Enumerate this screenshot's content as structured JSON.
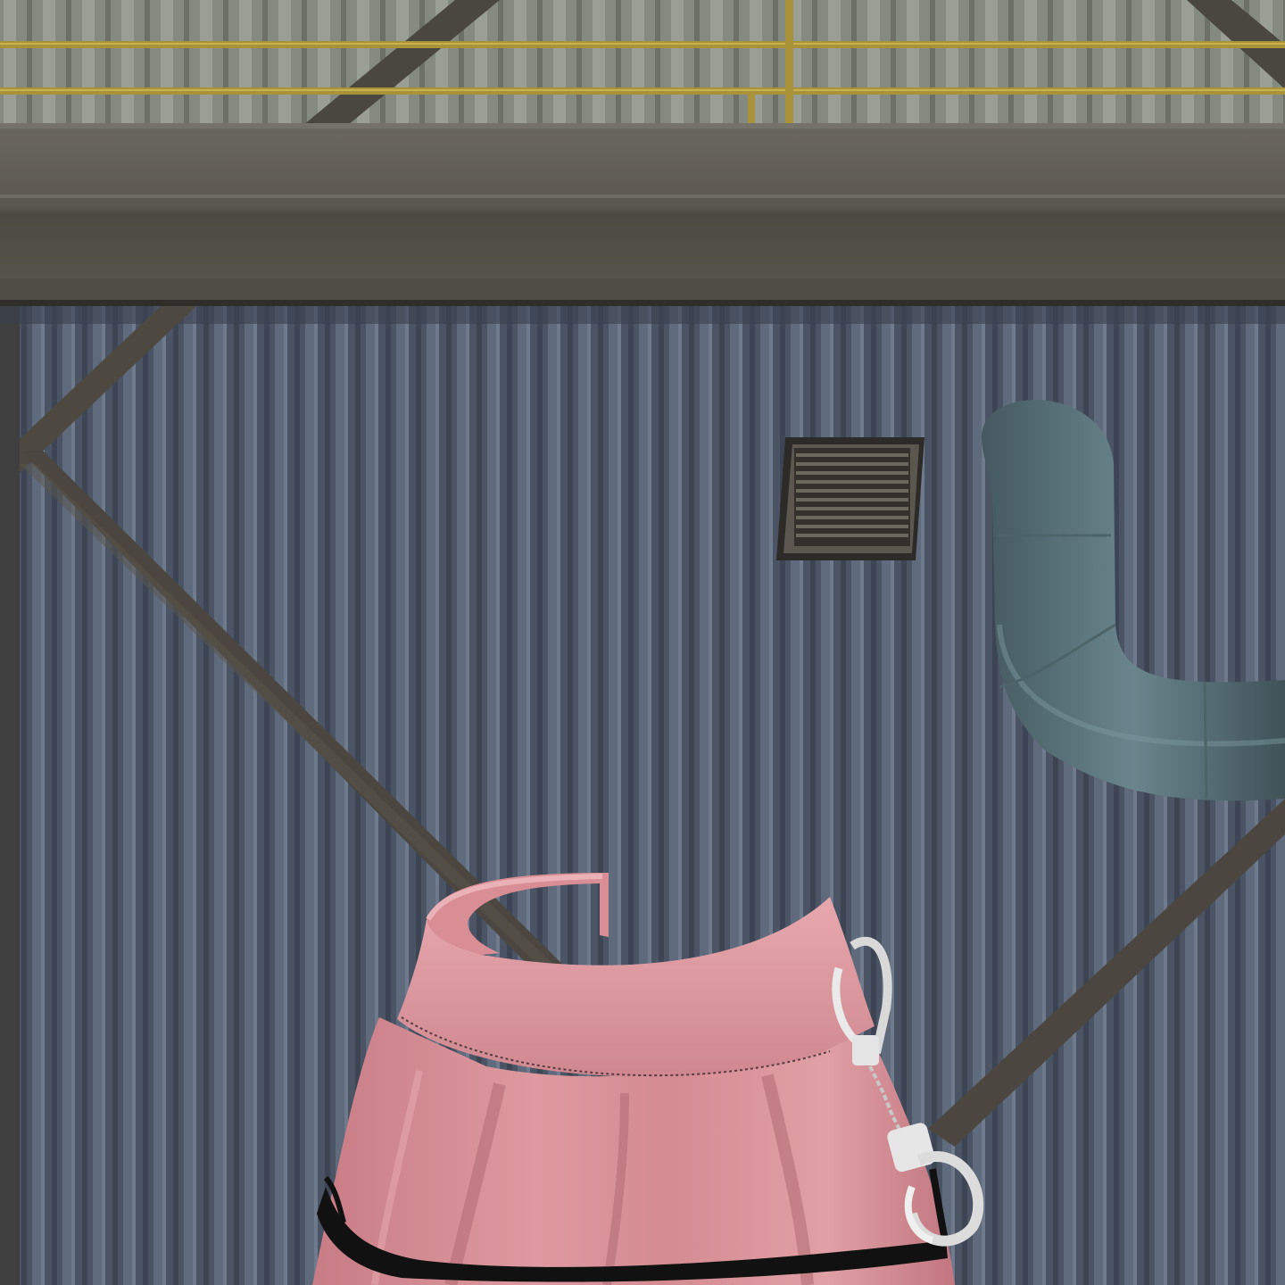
{
  "scene": {
    "kind": "clothing-preview",
    "item": "pink-pleated-skirt-with-handcuffs",
    "colors": {
      "upper_wall": "#8b8f86",
      "catwalk_rail": "#b09a3c",
      "concrete_beam": "#5d5a52",
      "wall_panel": "#4b5563",
      "wall_panel_highlight": "#6a7484",
      "steel_brace": "#4a4640",
      "vent": "#3d3a35",
      "duct": "#57707a",
      "skirt_pink": "#d68f94",
      "skirt_shadow": "#b46e76",
      "skirt_trim": "#111111",
      "handcuff_metal": "#dcdcdc"
    },
    "icons": [
      "vent-grille-icon",
      "duct-pipe-icon",
      "handcuffs-icon"
    ]
  }
}
